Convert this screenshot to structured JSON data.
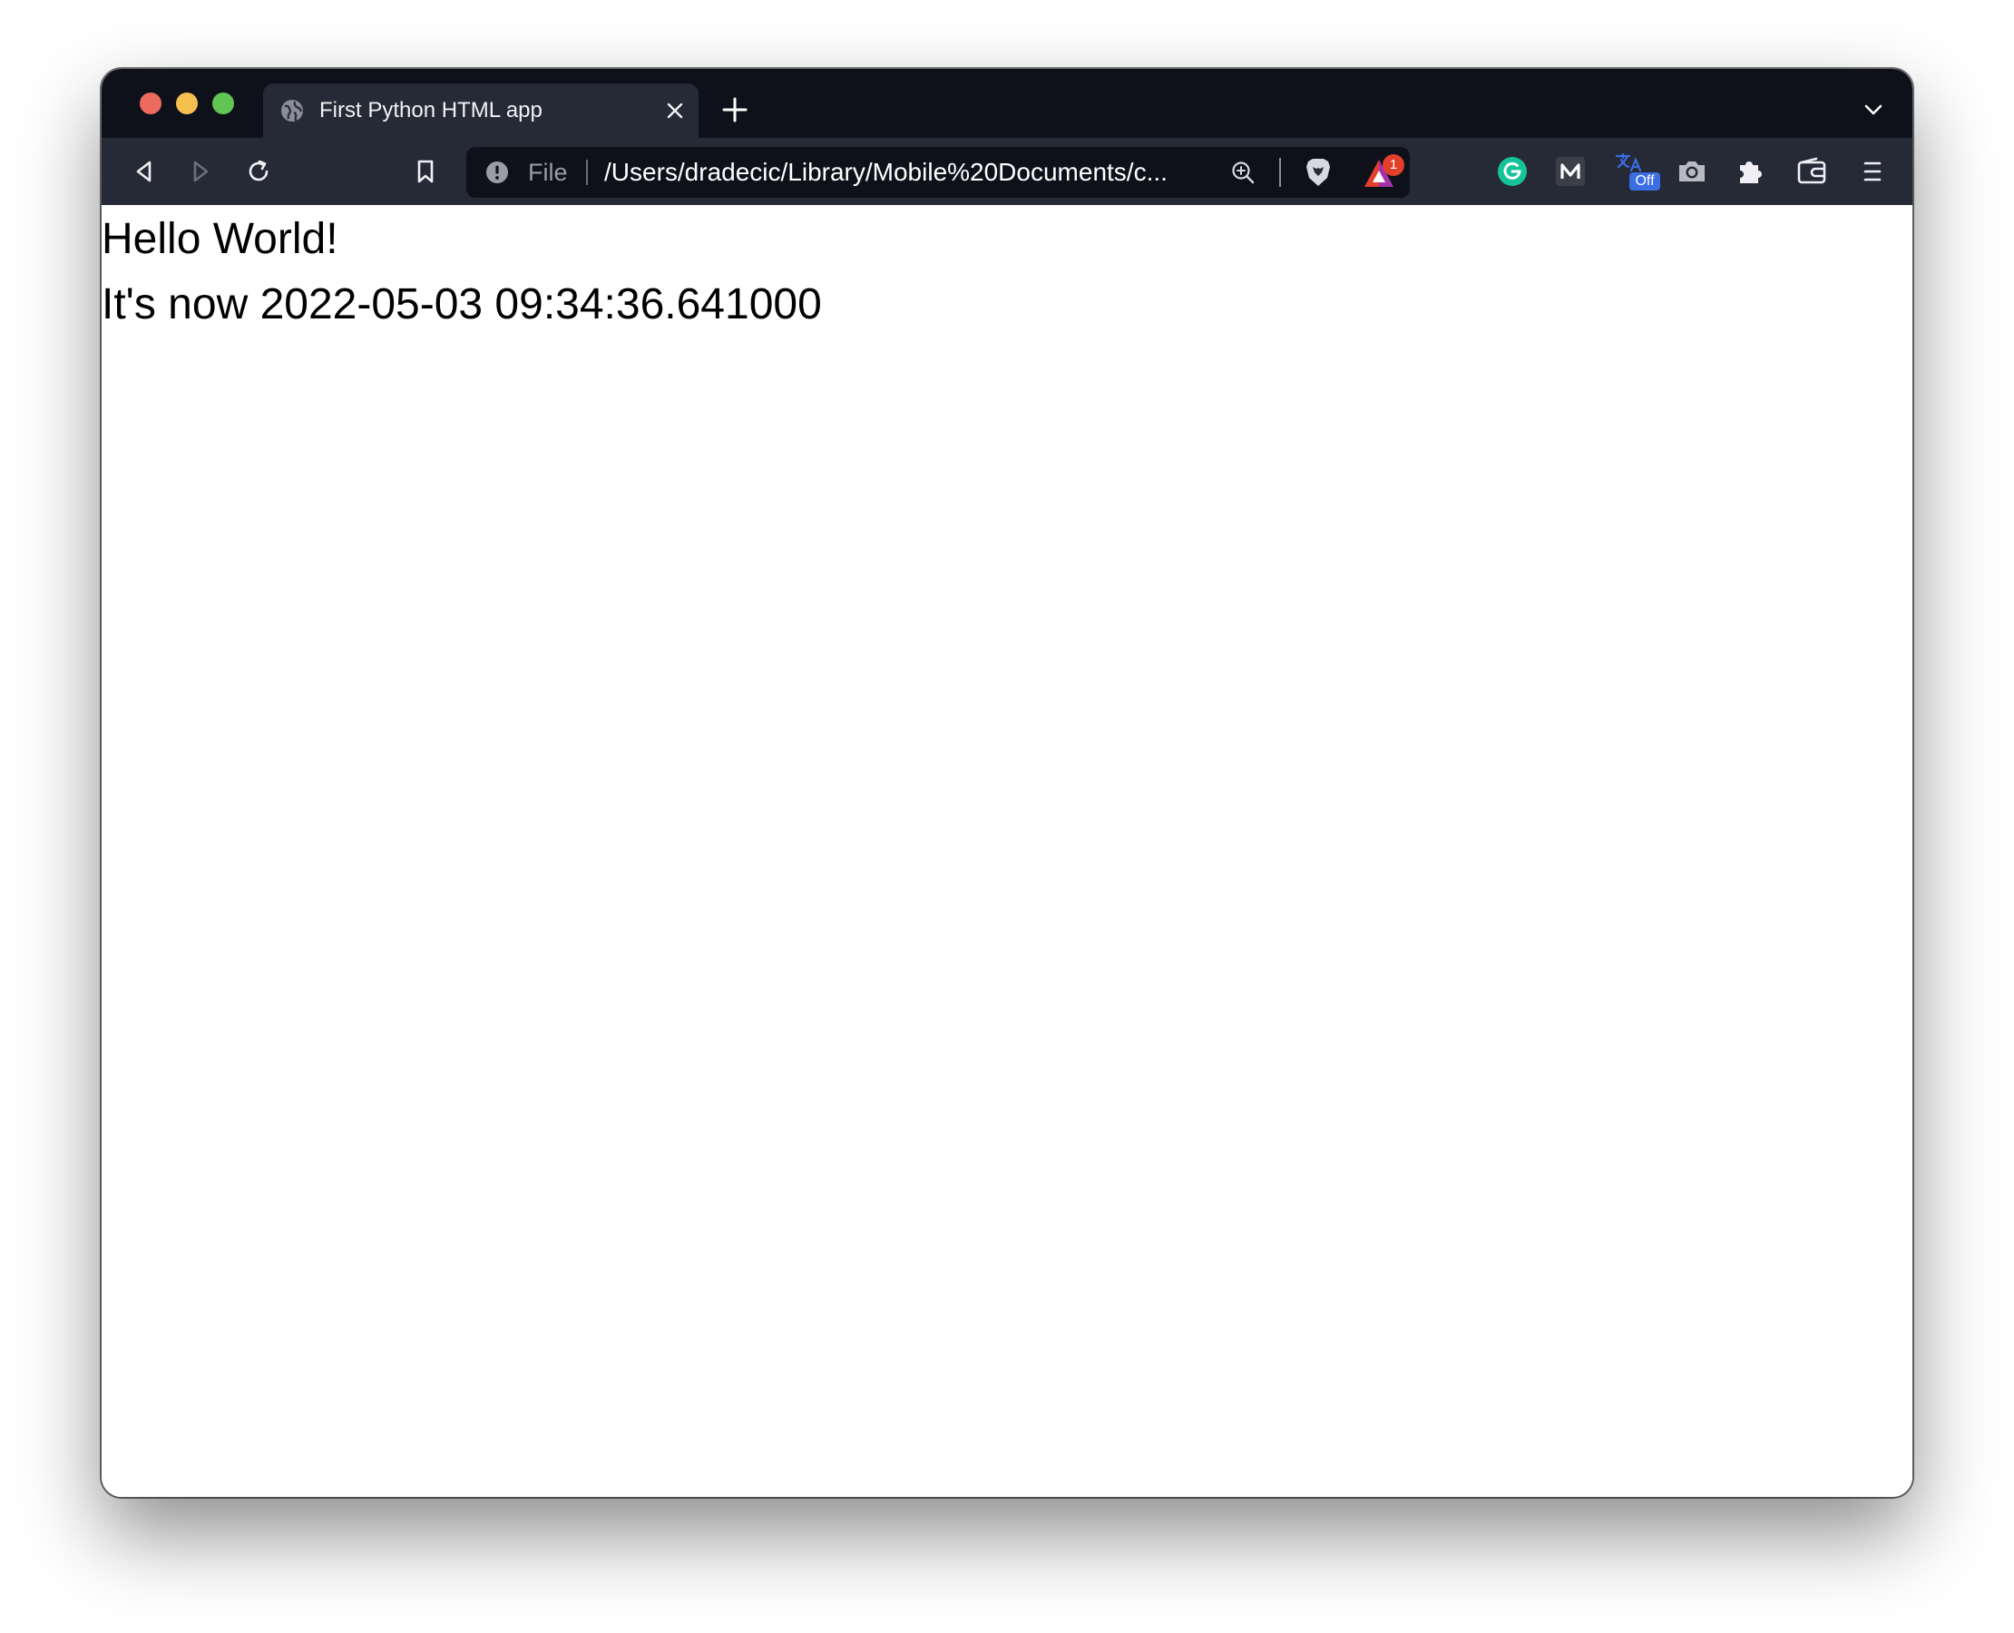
{
  "window": {
    "traffic_lights": [
      "close",
      "minimize",
      "maximize"
    ]
  },
  "tab": {
    "title": "First Python HTML app",
    "favicon": "globe-icon"
  },
  "toolbar": {
    "url_scheme": "File",
    "url": "/Users/dradecic/Library/Mobile%20Documents/c...",
    "rewards_badge": "1",
    "extension_off_label": "Off"
  },
  "page": {
    "heading": "Hello World!",
    "timestamp_line": "It's now 2022-05-03 09:34:36.641000"
  },
  "colors": {
    "tabstrip_bg": "#0f111a",
    "toolbar_bg": "#262a37",
    "urlbar_bg": "#0f111a",
    "rewards_badge": "#e2402b",
    "grammarly_green": "#15c39a"
  }
}
